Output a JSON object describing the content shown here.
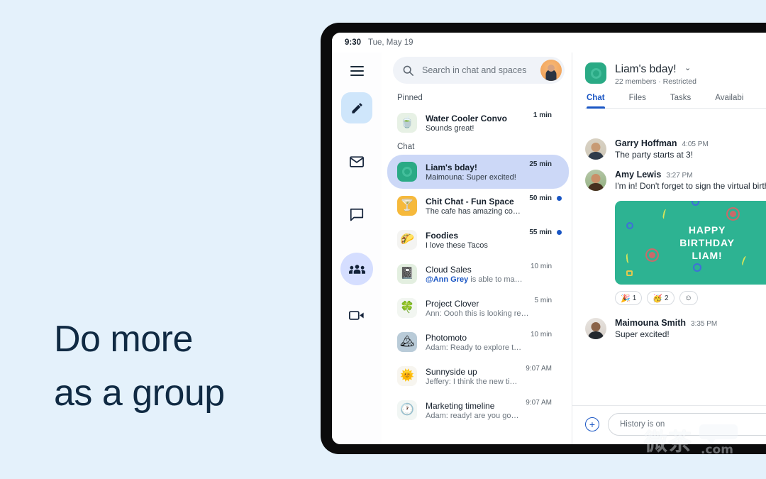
{
  "hero": {
    "line1": "Do more",
    "line2": "as a group"
  },
  "status_bar": {
    "time": "9:30",
    "date": "Tue, May 19"
  },
  "rail": {
    "items": [
      {
        "icon": "hamburger-menu-icon",
        "label": "Menu"
      },
      {
        "icon": "pencil-compose-icon",
        "label": "Compose"
      },
      {
        "icon": "mail-icon",
        "label": "Mail"
      },
      {
        "icon": "chat-bubble-icon",
        "label": "Chat"
      },
      {
        "icon": "people-spaces-icon",
        "label": "Spaces"
      },
      {
        "icon": "video-camera-icon",
        "label": "Meet"
      }
    ]
  },
  "search": {
    "placeholder": "Search in chat and spaces",
    "icon": "search-icon",
    "avatar": "user-avatar"
  },
  "chat_list": {
    "pinned_label": "Pinned",
    "chat_label": "Chat",
    "pinned": [
      {
        "name": "Water Cooler Convo",
        "preview": "Sounds great!",
        "time": "1 min",
        "emoji": "🍵",
        "avatar_color": "#e7f1e5",
        "unread": true,
        "dot": false
      }
    ],
    "chats": [
      {
        "name": "Liam's bday!",
        "preview": "Maimouna: Super excited!",
        "time": "25 min",
        "emoji": "",
        "avatar_color": "#2aaa85",
        "unread": true,
        "dot": false,
        "selected": true
      },
      {
        "name": "Chit Chat - Fun Space",
        "preview": "The cafe has amazing cookies today ...",
        "time": "50 min",
        "emoji": "🍸",
        "avatar_color": "#f6b93b",
        "unread": true,
        "dot": true
      },
      {
        "name": "Foodies",
        "preview": "I love these Tacos",
        "time": "55 min",
        "emoji": "🌮",
        "avatar_color": "#f4f4f2",
        "unread": true,
        "dot": true
      },
      {
        "name": "Cloud Sales",
        "preview_mention": "@Ann Grey",
        "preview": " is able to make the meet...",
        "time": "10 min",
        "emoji": "📓",
        "avatar_color": "#e3efe0",
        "unread": false,
        "dot": false
      },
      {
        "name": "Project Clover",
        "preview": "Ann: Oooh this is looking really good...",
        "time": "5 min",
        "emoji": "🍀",
        "avatar_color": "#f2f6f1",
        "unread": false,
        "dot": false
      },
      {
        "name": "Photomoto",
        "preview": "Adam: Ready to explore the new sol...",
        "time": "10 min",
        "emoji": "🏔",
        "avatar_color": "#b9cbd8",
        "unread": false,
        "dot": false
      },
      {
        "name": "Sunnyside up",
        "preview": "Jeffery: I think the new timeline is...",
        "time": "9:07 AM",
        "emoji": "🌞",
        "avatar_color": "#f7f5ef",
        "unread": false,
        "dot": false
      },
      {
        "name": "Marketing timeline",
        "preview": "Adam: ready! are you going to ma...",
        "time": "9:07 AM",
        "emoji": "🕐",
        "avatar_color": "#f1f6f4",
        "unread": false,
        "dot": false
      }
    ]
  },
  "conversation": {
    "title": "Liam's bday!",
    "caret": "⌄",
    "subtitle": "22 members · Restricted",
    "avatar_color": "#2aaa85",
    "tabs": [
      {
        "label": "Chat",
        "active": true
      },
      {
        "label": "Files",
        "active": false
      },
      {
        "label": "Tasks",
        "active": false
      },
      {
        "label": "Availabi",
        "active": false
      }
    ],
    "messages": [
      {
        "author": "Garry Hoffman",
        "time": "4:05 PM",
        "text": "The party starts at 3!"
      },
      {
        "author": "Amy Lewis",
        "time": "3:27 PM",
        "text": "I'm in! Don't forget to sign the virtual birth"
      },
      {
        "author": "Maimouna Smith",
        "time": "3:35 PM",
        "text": "Super excited!"
      }
    ],
    "card": {
      "line1": "HAPPY",
      "line2": "BIRTHDAY",
      "line3": "LIAM!",
      "bg": "#2db392"
    },
    "reactions": [
      {
        "emoji": "🎉",
        "count": "1"
      },
      {
        "emoji": "🥳",
        "count": "2"
      },
      {
        "emoji": "☺",
        "count": ""
      }
    ],
    "composer": {
      "placeholder": "History is on",
      "add_icon": "plus-circle-icon"
    }
  },
  "watermark": {
    "cn": "微茶",
    "domain": ".com"
  },
  "colors": {
    "page_bg": "#e4f1fb",
    "accent_blue": "#1a56c4",
    "selected_row": "#ccd8f7",
    "teal": "#2db392",
    "hero_text": "#102a43"
  }
}
